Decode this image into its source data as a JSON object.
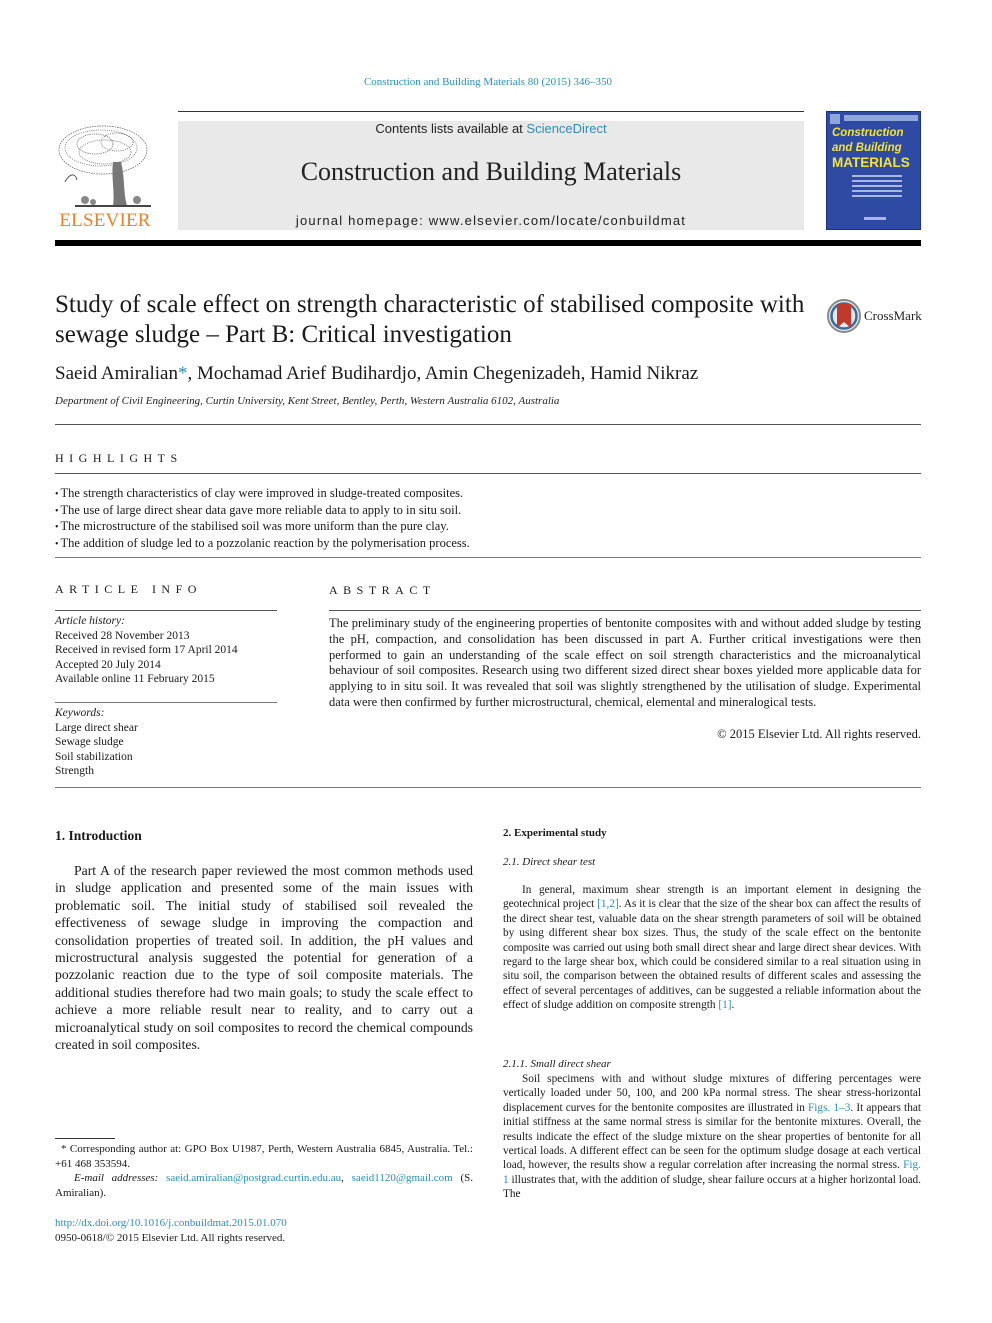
{
  "journal_ref": "Construction and Building Materials 80 (2015) 346–350",
  "masthead": {
    "publisher_logo_text": "ELSEVIER",
    "contents_prefix": "Contents lists available at ",
    "contents_link": "ScienceDirect",
    "journal_title": "Construction and Building Materials",
    "homepage": "journal homepage: www.elsevier.com/locate/conbuildmat",
    "cover": {
      "line1": "Construction",
      "line2": "and Building",
      "line3": "MATERIALS",
      "bg_color": "#2e4aa3",
      "title_color": "#f6e432"
    },
    "logo_color": "#f07f1e",
    "link_color": "#2b8fb8"
  },
  "article": {
    "title": "Study of scale effect on strength characteristic of stabilised composite with sewage sludge – Part B: Critical investigation",
    "crossmark_label": "CrossMark",
    "authors": [
      {
        "name": "Saeid Amiralian",
        "mark": "*"
      },
      {
        "name": "Mochamad Arief Budihardjo",
        "mark": ""
      },
      {
        "name": "Amin Chegenizadeh",
        "mark": ""
      },
      {
        "name": "Hamid Nikraz",
        "mark": ""
      }
    ],
    "affiliation": "Department of Civil Engineering, Curtin University, Kent Street, Bentley, Perth, Western Australia 6102, Australia"
  },
  "highlights": {
    "heading": "HIGHLIGHTS",
    "items": [
      "The strength characteristics of clay were improved in sludge-treated composites.",
      "The use of large direct shear data gave more reliable data to apply to in situ soil.",
      "The microstructure of the stabilised soil was more uniform than the pure clay.",
      "The addition of sludge led to a pozzolanic reaction by the polymerisation process."
    ]
  },
  "article_info": {
    "heading": "ARTICLE INFO",
    "history_label": "Article history:",
    "history": [
      "Received 28 November 2013",
      "Received in revised form 17 April 2014",
      "Accepted 20 July 2014",
      "Available online 11 February 2015"
    ],
    "keywords_label": "Keywords:",
    "keywords": [
      "Large direct shear",
      "Sewage sludge",
      "Soil stabilization",
      "Strength"
    ]
  },
  "abstract": {
    "heading": "ABSTRACT",
    "text": "The preliminary study of the engineering properties of bentonite composites with and without added sludge by testing the pH, compaction, and consolidation has been discussed in part A. Further critical investigations were then performed to gain an understanding of the scale effect on soil strength characteristics and the microanalytical behaviour of soil composites. Research using two different sized direct shear boxes yielded more applicable data for applying to in situ soil. It was revealed that soil was slightly strengthened by the utilisation of sludge. Experimental data were then confirmed by further microstructural, chemical, elemental and mineralogical tests.",
    "copyright": "© 2015 Elsevier Ltd. All rights reserved."
  },
  "sections": {
    "intro": {
      "heading": "1. Introduction",
      "text": "Part A of the research paper reviewed the most common methods used in sludge application and presented some of the main issues with problematic soil. The initial study of stabilised soil revealed the effectiveness of sewage sludge in improving the compaction and consolidation properties of treated soil. In addition, the pH values and microstructural analysis suggested the potential for generation of a pozzolanic reaction due to the type of soil composite materials. The additional studies therefore had two main goals; to study the scale effect to achieve a more reliable result near to reality, and to carry out a microanalytical study on soil composites to record the chemical compounds created in soil composites."
    },
    "experimental": {
      "heading": "2. Experimental study",
      "sub1_heading": "2.1. Direct shear test",
      "sub1_p1_a": "In general, maximum shear strength is an important element in designing the geotechnical project ",
      "sub1_ref1": "[1,2]",
      "sub1_p1_b": ". As it is clear that the size of the shear box can affect the results of the direct shear test, valuable data on the shear strength parameters of soil will be obtained by using different shear box sizes. Thus, the study of the scale effect on the bentonite composite was carried out using both small direct shear and large direct shear devices. With regard to the large shear box, which could be considered similar to a real situation using in situ soil, the comparison between the obtained results of different scales and assessing the effect of several percentages of additives, can be suggested a reliable information about the effect of sludge addition on composite strength ",
      "sub1_ref2": "[1]",
      "sub1_p1_c": ".",
      "sub2_heading": "2.1.1. Small direct shear",
      "sub2_p1_a": "Soil specimens with and without sludge mixtures of differing percentages were vertically loaded under 50, 100, and 200 kPa normal stress. The shear stress-horizontal displacement curves for the bentonite composites are illustrated in ",
      "sub2_ref1": "Figs. 1–3",
      "sub2_p1_b": ". It appears that initial stiffness at the same normal stress is similar for the bentonite mixtures. Overall, the results indicate the effect of the sludge mixture on the shear properties of bentonite for all vertical loads. A different effect can be seen for the optimum sludge dosage at each vertical load, however, the results show a regular correlation after increasing the normal stress. ",
      "sub2_ref2": "Fig. 1",
      "sub2_p1_c": " illustrates that, with the addition of sludge, shear failure occurs at a higher horizontal load. The"
    }
  },
  "footnotes": {
    "corresponding": "* Corresponding author at: GPO Box U1987, Perth, Western Australia 6845, Australia. Tel.: +61 468 353594.",
    "email_label": "E-mail addresses:",
    "email1": "saeid.amiralian@postgrad.curtin.edu.au",
    "email_sep": ", ",
    "email2": "saeid1120@gmail.com",
    "email_suffix": " (S. Amiralian).",
    "doi": "http://dx.doi.org/10.1016/j.conbuildmat.2015.01.070",
    "issn": "0950-0618/© 2015 Elsevier Ltd. All rights reserved."
  }
}
